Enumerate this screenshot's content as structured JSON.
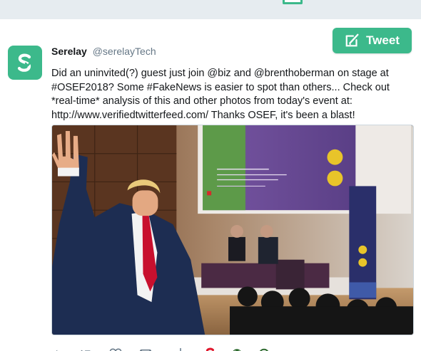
{
  "tweet_button": {
    "label": "Tweet"
  },
  "tweet": {
    "author": "Serelay",
    "handle": "@serelayTech",
    "text": "Did an uninvited(?) guest just join @biz and @brenthoberman on stage at #OSEF2018? Some #FakeNews is easier to spot than others... Check out *real-time* analysis of this and other photos from today's event at: http://www.verifiedtwitterfeed.com/ Thanks OSEF, it's been a blast!"
  },
  "media": {
    "slide_text": "Mr Stone (Twitter) in conversation with Brent Hoberman (Founders Forum, Firstminute capital)",
    "banner_text": "Oxford Saïd Entrepreneurship Forum"
  },
  "actions": {
    "icons": [
      "reply-icon",
      "retweet-icon",
      "like-icon",
      "dm-icon",
      "serelay-icon",
      "globe-icon",
      "clock-icon"
    ]
  },
  "colors": {
    "brand": "#3cb98b",
    "icon_gray": "#657786",
    "red": "#e0162b",
    "dark_green": "#2d6a2e"
  }
}
